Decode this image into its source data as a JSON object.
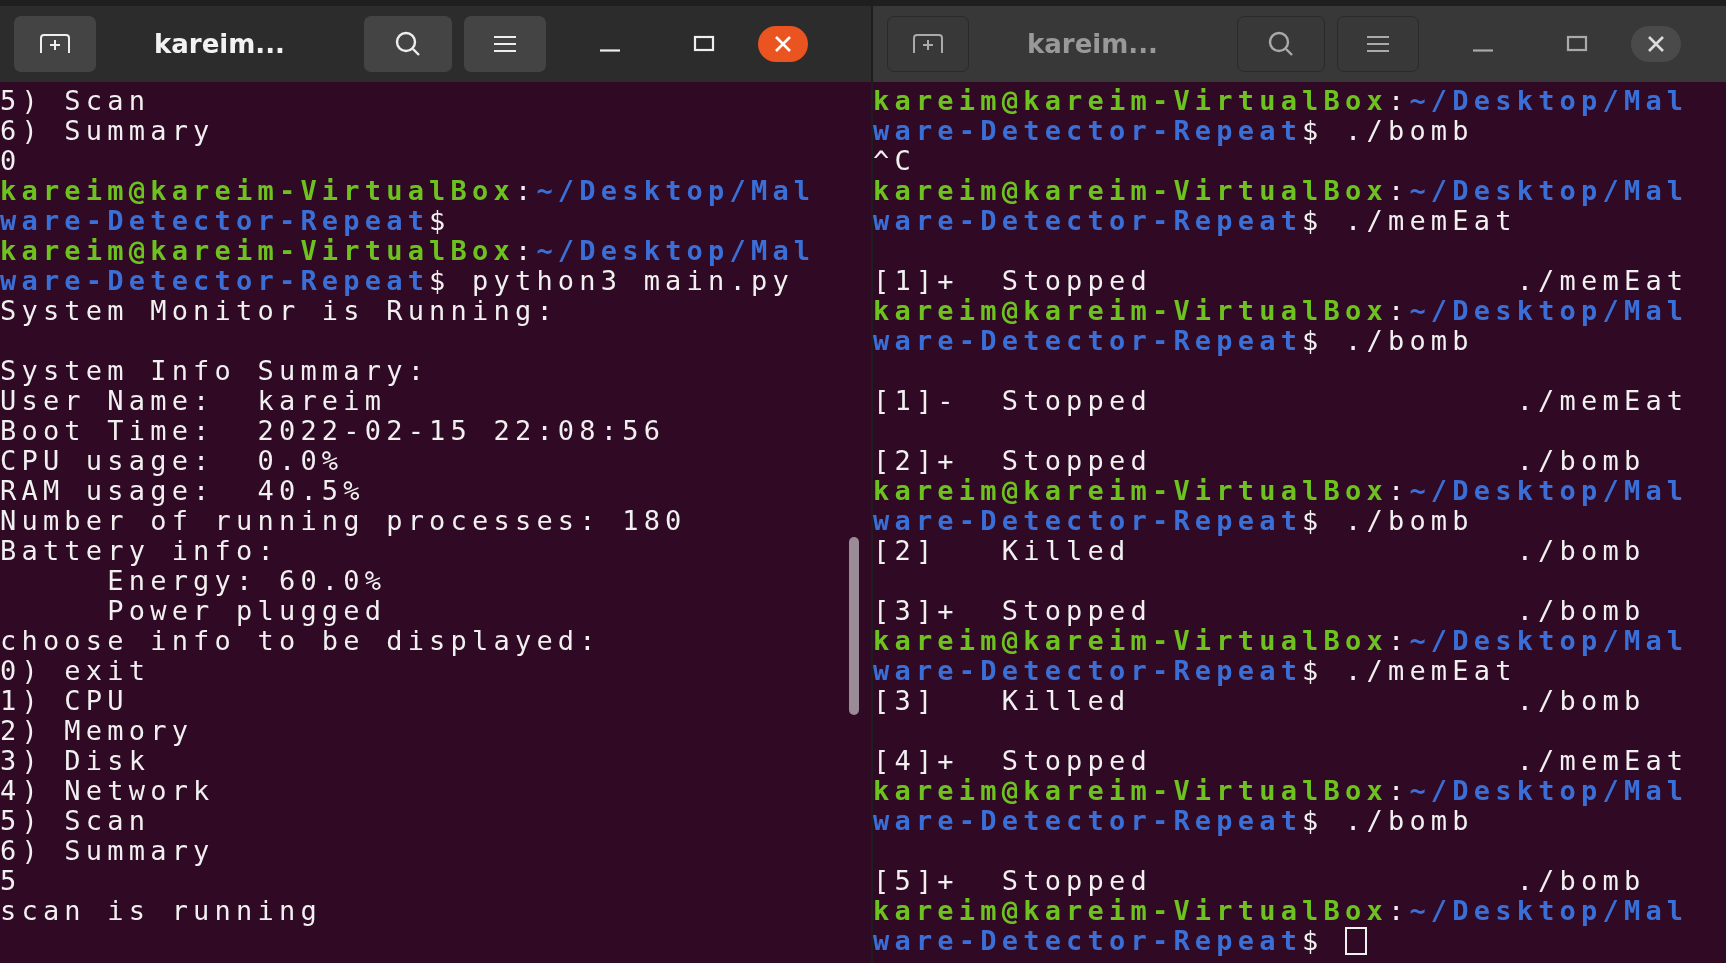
{
  "windows": [
    {
      "title": "kareim...",
      "active": true,
      "lines": [
        [
          {
            "kind": "plain",
            "text": "5) Scan"
          }
        ],
        [
          {
            "kind": "plain",
            "text": "6) Summary"
          }
        ],
        [
          {
            "kind": "plain",
            "text": "0"
          }
        ],
        [
          {
            "kind": "host",
            "text": "kareim@kareim-VirtualBox"
          },
          {
            "kind": "plain",
            "text": ":"
          },
          {
            "kind": "path",
            "text": "~/Desktop/Mal"
          }
        ],
        [
          {
            "kind": "path",
            "text": "ware-Detector-Repeat"
          },
          {
            "kind": "plain",
            "text": "$"
          }
        ],
        [
          {
            "kind": "host",
            "text": "kareim@kareim-VirtualBox"
          },
          {
            "kind": "plain",
            "text": ":"
          },
          {
            "kind": "path",
            "text": "~/Desktop/Mal"
          }
        ],
        [
          {
            "kind": "path",
            "text": "ware-Detector-Repeat"
          },
          {
            "kind": "plain",
            "text": "$ python3 main.py"
          }
        ],
        [
          {
            "kind": "plain",
            "text": "System Monitor is Running:"
          }
        ],
        [
          {
            "kind": "blank"
          }
        ],
        [
          {
            "kind": "plain",
            "text": "System Info Summary:"
          }
        ],
        [
          {
            "kind": "plain",
            "text": "User Name:  kareim"
          }
        ],
        [
          {
            "kind": "plain",
            "text": "Boot Time:  2022-02-15 22:08:56"
          }
        ],
        [
          {
            "kind": "plain",
            "text": "CPU usage:  0.0%"
          }
        ],
        [
          {
            "kind": "plain",
            "text": "RAM usage:  40.5%"
          }
        ],
        [
          {
            "kind": "plain",
            "text": "Number of running processes: 180"
          }
        ],
        [
          {
            "kind": "plain",
            "text": "Battery info:"
          }
        ],
        [
          {
            "kind": "plain",
            "text": "     Energy: 60.0%"
          }
        ],
        [
          {
            "kind": "plain",
            "text": "     Power plugged"
          }
        ],
        [
          {
            "kind": "plain",
            "text": "choose info to be displayed:"
          }
        ],
        [
          {
            "kind": "plain",
            "text": "0) exit"
          }
        ],
        [
          {
            "kind": "plain",
            "text": "1) CPU"
          }
        ],
        [
          {
            "kind": "plain",
            "text": "2) Memory"
          }
        ],
        [
          {
            "kind": "plain",
            "text": "3) Disk"
          }
        ],
        [
          {
            "kind": "plain",
            "text": "4) Network"
          }
        ],
        [
          {
            "kind": "plain",
            "text": "5) Scan"
          }
        ],
        [
          {
            "kind": "plain",
            "text": "6) Summary"
          }
        ],
        [
          {
            "kind": "plain",
            "text": "5"
          }
        ],
        [
          {
            "kind": "plain",
            "text": "scan is running"
          }
        ]
      ]
    },
    {
      "title": "kareim...",
      "active": false,
      "cursor": true,
      "lines": [
        [
          {
            "kind": "host",
            "text": "kareim@kareim-VirtualBox"
          },
          {
            "kind": "plain",
            "text": ":"
          },
          {
            "kind": "path",
            "text": "~/Desktop/Mal"
          }
        ],
        [
          {
            "kind": "path",
            "text": "ware-Detector-Repeat"
          },
          {
            "kind": "plain",
            "text": "$ ./bomb"
          }
        ],
        [
          {
            "kind": "plain",
            "text": "^C"
          }
        ],
        [
          {
            "kind": "host",
            "text": "kareim@kareim-VirtualBox"
          },
          {
            "kind": "plain",
            "text": ":"
          },
          {
            "kind": "path",
            "text": "~/Desktop/Mal"
          }
        ],
        [
          {
            "kind": "path",
            "text": "ware-Detector-Repeat"
          },
          {
            "kind": "plain",
            "text": "$ ./memEat"
          }
        ],
        [
          {
            "kind": "blank"
          }
        ],
        [
          {
            "kind": "plain",
            "text": "[1]+  Stopped                 ./memEat"
          }
        ],
        [
          {
            "kind": "host",
            "text": "kareim@kareim-VirtualBox"
          },
          {
            "kind": "plain",
            "text": ":"
          },
          {
            "kind": "path",
            "text": "~/Desktop/Mal"
          }
        ],
        [
          {
            "kind": "path",
            "text": "ware-Detector-Repeat"
          },
          {
            "kind": "plain",
            "text": "$ ./bomb"
          }
        ],
        [
          {
            "kind": "blank"
          }
        ],
        [
          {
            "kind": "plain",
            "text": "[1]-  Stopped                 ./memEat"
          }
        ],
        [
          {
            "kind": "blank"
          }
        ],
        [
          {
            "kind": "plain",
            "text": "[2]+  Stopped                 ./bomb"
          }
        ],
        [
          {
            "kind": "host",
            "text": "kareim@kareim-VirtualBox"
          },
          {
            "kind": "plain",
            "text": ":"
          },
          {
            "kind": "path",
            "text": "~/Desktop/Mal"
          }
        ],
        [
          {
            "kind": "path",
            "text": "ware-Detector-Repeat"
          },
          {
            "kind": "plain",
            "text": "$ ./bomb"
          }
        ],
        [
          {
            "kind": "plain",
            "text": "[2]   Killed                  ./bomb"
          }
        ],
        [
          {
            "kind": "blank"
          }
        ],
        [
          {
            "kind": "plain",
            "text": "[3]+  Stopped                 ./bomb"
          }
        ],
        [
          {
            "kind": "host",
            "text": "kareim@kareim-VirtualBox"
          },
          {
            "kind": "plain",
            "text": ":"
          },
          {
            "kind": "path",
            "text": "~/Desktop/Mal"
          }
        ],
        [
          {
            "kind": "path",
            "text": "ware-Detector-Repeat"
          },
          {
            "kind": "plain",
            "text": "$ ./memEat"
          }
        ],
        [
          {
            "kind": "plain",
            "text": "[3]   Killed                  ./bomb"
          }
        ],
        [
          {
            "kind": "blank"
          }
        ],
        [
          {
            "kind": "plain",
            "text": "[4]+  Stopped                 ./memEat"
          }
        ],
        [
          {
            "kind": "host",
            "text": "kareim@kareim-VirtualBox"
          },
          {
            "kind": "plain",
            "text": ":"
          },
          {
            "kind": "path",
            "text": "~/Desktop/Mal"
          }
        ],
        [
          {
            "kind": "path",
            "text": "ware-Detector-Repeat"
          },
          {
            "kind": "plain",
            "text": "$ ./bomb"
          }
        ],
        [
          {
            "kind": "blank"
          }
        ],
        [
          {
            "kind": "plain",
            "text": "[5]+  Stopped                 ./bomb"
          }
        ],
        [
          {
            "kind": "host",
            "text": "kareim@kareim-VirtualBox"
          },
          {
            "kind": "plain",
            "text": ":"
          },
          {
            "kind": "path",
            "text": "~/Desktop/Mal"
          }
        ],
        [
          {
            "kind": "path",
            "text": "ware-Detector-Repeat"
          },
          {
            "kind": "plain",
            "text": "$ "
          }
        ]
      ]
    }
  ]
}
